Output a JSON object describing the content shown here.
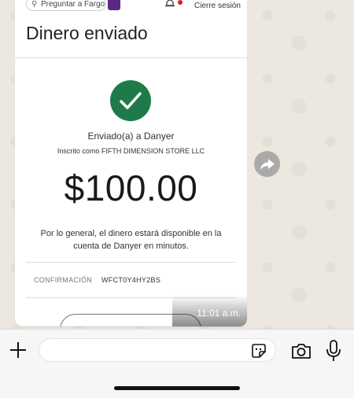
{
  "bank_screen": {
    "search_placeholder": "Preguntar a Fargo",
    "logout_label": "Cierre sesión",
    "title": "Dinero enviado",
    "sent_to": "Enviado(a) a Danyer",
    "enrolled_as": "Inscrito como FIFTH DIMENSION STORE LLC",
    "amount": "$100.00",
    "availability_message": "Por lo general, el dinero estará disponible en la cuenta de Danyer en minutos.",
    "confirmation_label": "CONFIRMACIÓN",
    "confirmation_value": "WFCT0Y4HY2BS"
  },
  "message": {
    "timestamp": "11:01 a.m."
  },
  "icons": {
    "success": "check-circle-icon",
    "forward": "forward-icon",
    "attach": "plus-icon",
    "sticker": "sticker-icon",
    "camera": "camera-icon",
    "mic": "microphone-icon"
  },
  "colors": {
    "success_green": "#1f7a4a",
    "brand_purple": "#5a2a82",
    "alert_red": "#d71e28"
  }
}
